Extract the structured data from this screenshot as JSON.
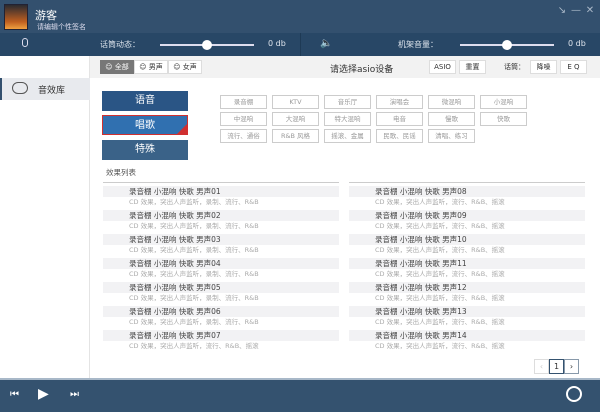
{
  "header": {
    "username": "游客",
    "signature": "请编辑个性签名"
  },
  "controls": {
    "mic_label": "话筒动态：",
    "mic_value_label": "0 db",
    "mic_level": 0.5,
    "machine_label": "机架音量：",
    "machine_value_label": "0 db",
    "machine_level": 0.5
  },
  "sidebar": {
    "items": [
      {
        "label": "音效库"
      }
    ]
  },
  "toolbar": {
    "filters": [
      "全部",
      "男声",
      "女声"
    ],
    "device_prompt": "请选择asio设备",
    "asio": "ASIO",
    "reset": "重置",
    "mic_label": "话筒：",
    "denoise": "降噪",
    "eq": "E Q"
  },
  "categories": [
    "语音",
    "唱歌",
    "特殊"
  ],
  "selected_category": "唱歌",
  "tags": [
    "录音棚",
    "KTV",
    "音乐厅",
    "演唱会",
    "微混响",
    "小混响",
    "中混响",
    "大混响",
    "特大混响",
    "电音",
    "慢歌",
    "快歌",
    "流行、通俗",
    "R&B 风格",
    "摇滚、金属",
    "民歌、民谣",
    "清唱、练习"
  ],
  "list_title": "效果列表",
  "effects_left": [
    {
      "title": "录音棚 小混响 快歌  男声01",
      "desc": "CD 效果，突出人声监听，录制、流行、R&B"
    },
    {
      "title": "录音棚 小混响 快歌  男声02",
      "desc": "CD 效果，突出人声监听，录制、流行、R&B"
    },
    {
      "title": "录音棚 小混响 快歌  男声03",
      "desc": "CD 效果，突出人声监听，录制、流行、R&B"
    },
    {
      "title": "录音棚 小混响 快歌  男声04",
      "desc": "CD 效果，突出人声监听，录制、流行、R&B"
    },
    {
      "title": "录音棚 小混响 快歌  男声05",
      "desc": "CD 效果，突出人声监听，录制、流行、R&B"
    },
    {
      "title": "录音棚 小混响 快歌  男声06",
      "desc": "CD 效果，突出人声监听，录制、流行、R&B"
    },
    {
      "title": "录音棚 小混响 快歌  男声07",
      "desc": "CD 效果，突出人声监听，流行、R&B、摇滚"
    }
  ],
  "effects_right": [
    {
      "title": "录音棚 小混响 快歌  男声08",
      "desc": "CD 效果，突出人声监听，流行、R&B、摇滚"
    },
    {
      "title": "录音棚 小混响 快歌  男声09",
      "desc": "CD 效果，突出人声监听，流行、R&B、摇滚"
    },
    {
      "title": "录音棚 小混响 快歌  男声10",
      "desc": "CD 效果，突出人声监听，流行、R&B、摇滚"
    },
    {
      "title": "录音棚 小混响 快歌  男声11",
      "desc": "CD 效果，突出人声监听，流行、R&B、摇滚"
    },
    {
      "title": "录音棚 小混响 快歌  男声12",
      "desc": "CD 效果，突出人声监听，流行、R&B、摇滚"
    },
    {
      "title": "录音棚 小混响 快歌  男声13",
      "desc": "CD 效果，突出人声监听，流行、R&B、摇滚"
    },
    {
      "title": "录音棚 小混响 快歌  男声14",
      "desc": "CD 效果，突出人声监听，流行、R&B、摇滚"
    }
  ],
  "pagination": {
    "current": "1",
    "prev": "‹",
    "next": "›"
  },
  "colors": {
    "header": "#33506e",
    "bar": "#284766",
    "accent": "#2d5a8a",
    "selected_border": "#d03030"
  }
}
